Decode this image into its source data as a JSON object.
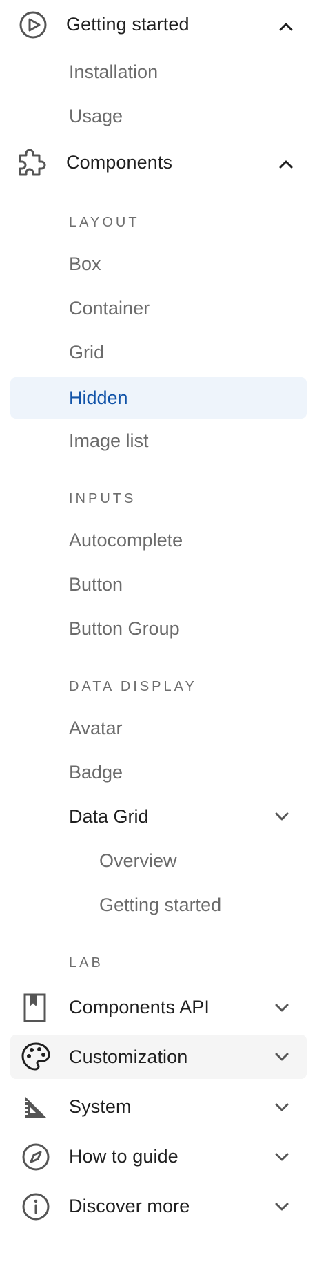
{
  "nav": {
    "getting_started": {
      "label": "Getting started",
      "icon": "play-circle-icon",
      "expanded": true,
      "children": [
        "Installation",
        "Usage"
      ]
    },
    "components": {
      "label": "Components",
      "icon": "puzzle-icon",
      "expanded": true
    },
    "sections": {
      "layout": "LAYOUT",
      "inputs": "INPUTS",
      "data_display": "DATA DISPLAY",
      "lab": "LAB"
    },
    "layout_items": [
      "Box",
      "Container",
      "Grid",
      "Hidden",
      "Image list"
    ],
    "active_item": "Hidden",
    "inputs_items": [
      "Autocomplete",
      "Button",
      "Button Group"
    ],
    "data_display_items": [
      "Avatar",
      "Badge"
    ],
    "data_grid": {
      "label": "Data Grid",
      "expanded": true,
      "children": [
        "Overview",
        "Getting started"
      ]
    },
    "bottom_items": [
      {
        "label": "Components API",
        "icon": "bookmark-book-icon",
        "expanded": false
      },
      {
        "label": "Customization",
        "icon": "palette-icon",
        "expanded": false,
        "hovered": true
      },
      {
        "label": "System",
        "icon": "set-square-ruler-icon",
        "expanded": false
      },
      {
        "label": "How to guide",
        "icon": "compass-icon",
        "expanded": false
      },
      {
        "label": "Discover more",
        "icon": "info-icon",
        "expanded": false
      }
    ]
  },
  "colors": {
    "active_bg": "#eef4fb",
    "active_text": "#1153a8",
    "hover_bg": "#f5f5f5",
    "icon": "#555555",
    "muted_text": "#6b6b6b"
  }
}
